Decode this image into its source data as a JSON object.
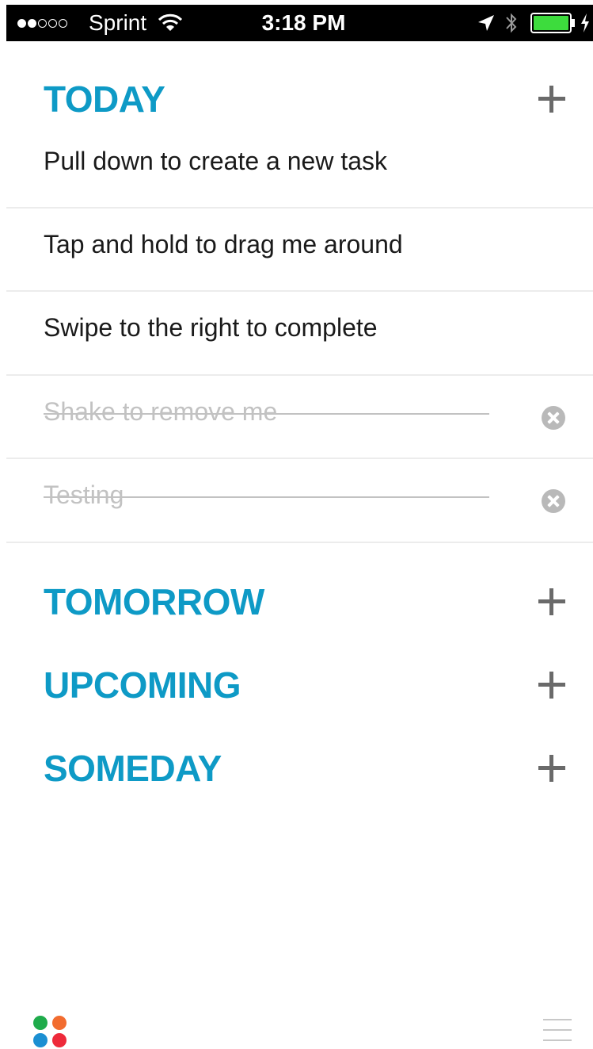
{
  "status_bar": {
    "signal_bars_filled": 2,
    "signal_bars_total": 5,
    "carrier": "Sprint",
    "time": "3:18 PM",
    "battery_color": "#3ddc3d"
  },
  "colors": {
    "section_title": "#0e9ac6",
    "task_text": "#1a1a1a",
    "completed_text": "#c2c2c2"
  },
  "sections": {
    "today": {
      "title": "TODAY",
      "tasks": [
        {
          "label": "Pull down to create a new task",
          "completed": false
        },
        {
          "label": "Tap and hold to drag me around",
          "completed": false
        },
        {
          "label": "Swipe to the right to complete",
          "completed": false
        },
        {
          "label": "Shake to remove me",
          "completed": true
        },
        {
          "label": "Testing",
          "completed": true
        }
      ]
    },
    "tomorrow": {
      "title": "TOMORROW"
    },
    "upcoming": {
      "title": "UPCOMING"
    },
    "someday": {
      "title": "SOMEDAY"
    }
  },
  "footer": {
    "logo_dot_colors": [
      "#1fab4b",
      "#f26c2f",
      "#1b8fd2",
      "#ee2a3a"
    ],
    "menu_icon": "hamburger-menu-icon"
  }
}
